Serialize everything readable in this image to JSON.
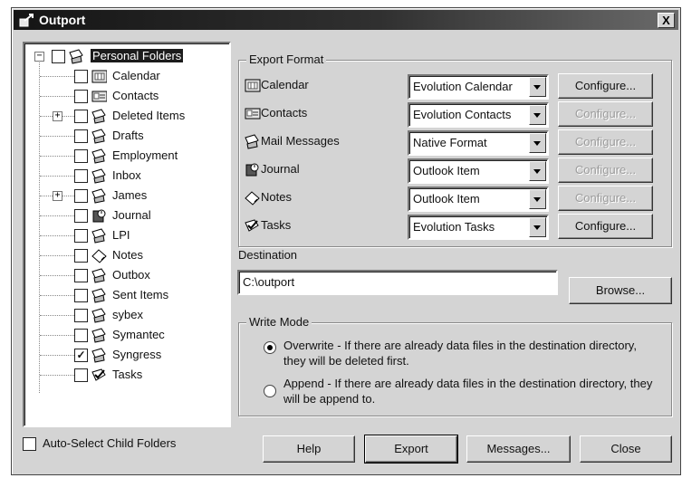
{
  "window": {
    "title": "Outport",
    "close_label": "X"
  },
  "tree": {
    "root": {
      "label": "Personal Folders",
      "expander": "−",
      "checked": false
    },
    "items": [
      {
        "label": "Calendar",
        "icon": "calendar-icon",
        "checked": false,
        "expander": ""
      },
      {
        "label": "Contacts",
        "icon": "contacts-icon",
        "checked": false,
        "expander": ""
      },
      {
        "label": "Deleted Items",
        "icon": "mail-folder-icon",
        "checked": false,
        "expander": "+"
      },
      {
        "label": "Drafts",
        "icon": "mail-folder-icon",
        "checked": false,
        "expander": ""
      },
      {
        "label": "Employment",
        "icon": "mail-folder-icon",
        "checked": false,
        "expander": ""
      },
      {
        "label": "Inbox",
        "icon": "mail-folder-icon",
        "checked": false,
        "expander": ""
      },
      {
        "label": "James",
        "icon": "mail-folder-icon",
        "checked": false,
        "expander": "+"
      },
      {
        "label": "Journal",
        "icon": "journal-icon",
        "checked": false,
        "expander": ""
      },
      {
        "label": "LPI",
        "icon": "mail-folder-icon",
        "checked": false,
        "expander": ""
      },
      {
        "label": "Notes",
        "icon": "notes-icon",
        "checked": false,
        "expander": ""
      },
      {
        "label": "Outbox",
        "icon": "mail-folder-icon",
        "checked": false,
        "expander": ""
      },
      {
        "label": "Sent Items",
        "icon": "mail-folder-icon",
        "checked": false,
        "expander": ""
      },
      {
        "label": "sybex",
        "icon": "mail-folder-icon",
        "checked": false,
        "expander": ""
      },
      {
        "label": "Symantec",
        "icon": "mail-folder-icon",
        "checked": false,
        "expander": ""
      },
      {
        "label": "Syngress",
        "icon": "mail-folder-icon",
        "checked": true,
        "expander": ""
      },
      {
        "label": "Tasks",
        "icon": "tasks-icon",
        "checked": false,
        "expander": ""
      }
    ]
  },
  "auto_select": {
    "label": "Auto-Select Child Folders",
    "checked": false
  },
  "export_format": {
    "legend": "Export Format",
    "rows": [
      {
        "label": "Calendar",
        "icon": "calendar-icon",
        "value": "Evolution Calendar",
        "configure": "Configure...",
        "configure_enabled": true
      },
      {
        "label": "Contacts",
        "icon": "contacts-icon",
        "value": "Evolution Contacts",
        "configure": "Configure...",
        "configure_enabled": false
      },
      {
        "label": "Mail Messages",
        "icon": "mail-icon",
        "value": "Native Format",
        "configure": "Configure...",
        "configure_enabled": false
      },
      {
        "label": "Journal",
        "icon": "journal-icon",
        "value": "Outlook Item",
        "configure": "Configure...",
        "configure_enabled": false
      },
      {
        "label": "Notes",
        "icon": "notes-icon",
        "value": "Outlook Item",
        "configure": "Configure...",
        "configure_enabled": false
      },
      {
        "label": "Tasks",
        "icon": "tasks-icon",
        "value": "Evolution Tasks",
        "configure": "Configure...",
        "configure_enabled": true
      }
    ]
  },
  "destination": {
    "label": "Destination",
    "value": "C:\\outport",
    "browse": "Browse..."
  },
  "write_mode": {
    "legend": "Write Mode",
    "overwrite": {
      "text": "Overwrite - If there are already data files in the destination directory, they will be deleted first.",
      "selected": true
    },
    "append": {
      "text": "Append - If there are already data files in the destination directory, they will be append to.",
      "selected": false
    }
  },
  "buttons": {
    "help": "Help",
    "export": "Export",
    "messages": "Messages...",
    "close": "Close"
  }
}
